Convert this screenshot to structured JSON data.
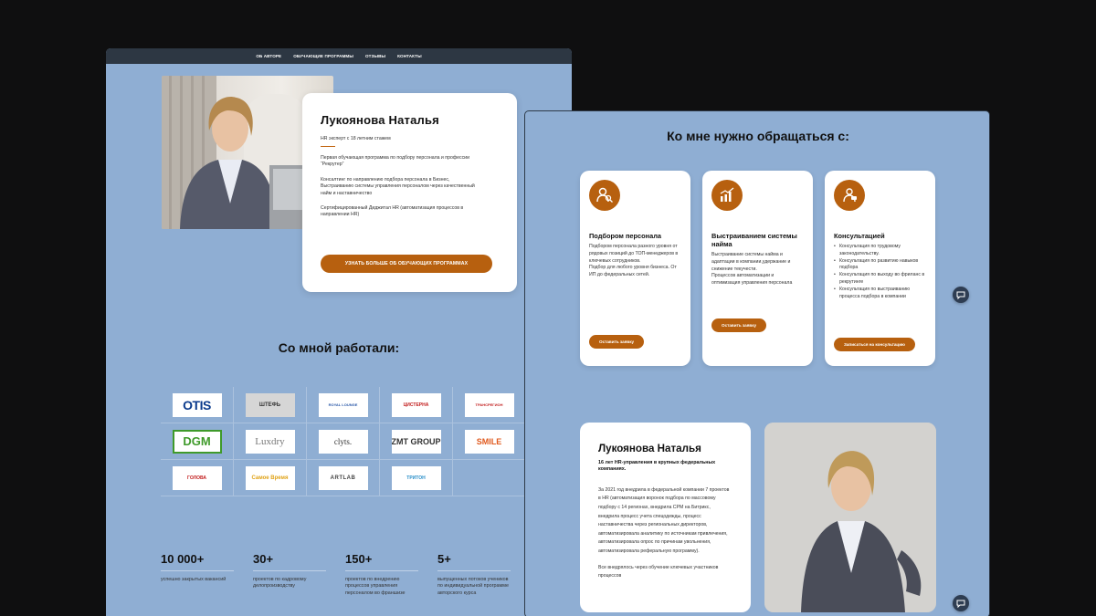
{
  "nav": {
    "items": [
      "ОБ АВТОРЕ",
      "ОБУЧАЮЩИЕ ПРОГРАММЫ",
      "ОТЗЫВЫ",
      "КОНТАКТЫ"
    ]
  },
  "hero": {
    "name": "Лукоянова Наталья",
    "subtitle": "HR эксперт с 18 летним стажем",
    "paragraphs": [
      "Первая обучающая программа по подбору персонала и профессии “Рекрутер”",
      "Консалтинг по направлению подбора персонала в Бизнес, Выстраиванию системы управления персоналом через качественный найм и наставничество",
      "Сертифицированный Диджитал HR (автоматизация процессов в направлении HR)"
    ],
    "button": "УЗНАТЬ БОЛЬШЕ ОБ ОБУЧАЮЩИХ ПРОГРАММАХ"
  },
  "clients": {
    "title": "Со мной работали:",
    "logos": [
      "OTIS",
      "ШТЕФЬ",
      "ROYAL LOUNGE",
      "ЦИСТЕРНА",
      "ТРАНСРЕГИОН",
      "DGM",
      "Luxdry",
      "clyts.",
      "ZMT GROUP",
      "SMILE",
      "ГОЛОВА",
      "Самое Время",
      "ARTLAB",
      "ТРИТОН",
      ""
    ]
  },
  "stats": [
    {
      "num": "10 000+",
      "label": "успешно закрытых вакансий"
    },
    {
      "num": "30+",
      "label": "проектов по кадровому делопроизводству"
    },
    {
      "num": "150+",
      "label": "проектов по внедрению процессов управления персоналом во франшизе"
    },
    {
      "num": "5+",
      "label": "выпущенных потоков учеников по индивидуальной программе авторского курса"
    }
  ],
  "services": {
    "title": "Ко мне нужно обращаться с:",
    "cards": [
      {
        "icon": "people-search-icon",
        "title": "Подбором персонала",
        "text": "Подбором персонала разного уровня от рядовых позиций до ТОП-менеджеров в ключевых сотрудников.\nПодбор для любого уровня бизнеса. От ИП до федеральных сетей.",
        "button": "Оставить заявку"
      },
      {
        "icon": "growth-chart-icon",
        "title": "Выстраиванием системы найма",
        "text": "Выстраивание системы найма и адаптации в компании,удержание и снижение текучести.\nПроцессов автоматизации и оптимизация управления персонала",
        "button": "Оставить заявку"
      },
      {
        "icon": "consultant-icon",
        "title": "Консультацией",
        "list": [
          "Консультация по трудовому законодательству.",
          "Консультация по развитию навыков подбора",
          "Консультация по выходу во фриланс в рекрутинге",
          "Консультация по выстраиванию процесса подбора в компании"
        ],
        "button": "Записаться на консультацию"
      }
    ]
  },
  "about": {
    "name": "Лукоянова Наталья",
    "subtitle": "16 лет HR-управления в крупных федеральных компаниях.",
    "paragraph1": "За 2021 год внедрила в федеральной компании 7 проектов в HR (автоматизация воронок подбора по массовому подбору с 14 регионах, внедрила CPM на Битрикс, внедрила процесс учета спецодежды, процесс наставничества через региональных директоров, автоматизировала аналитику по источникам привлечения, автоматизировала опрос по причинам увольнения, автоматизировала реферальную программу).",
    "paragraph2": "Все внедрялось через обучение ключевых участников процессов"
  },
  "colors": {
    "accent": "#b7600f",
    "bg": "#8faed3",
    "nav": "#2d3743"
  }
}
